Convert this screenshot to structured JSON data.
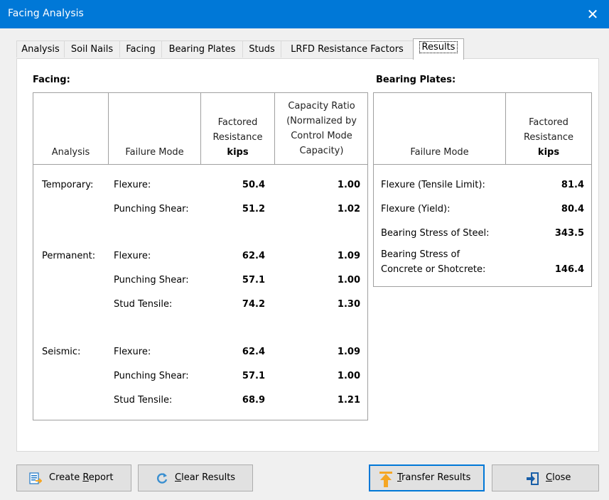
{
  "window": {
    "title": "Facing Analysis",
    "close_glyph": "✕"
  },
  "tabs": [
    {
      "label": "Analysis"
    },
    {
      "label": "Soil Nails"
    },
    {
      "label": "Facing"
    },
    {
      "label": "Bearing Plates"
    },
    {
      "label": "Studs"
    },
    {
      "label": "LRFD Resistance Factors"
    },
    {
      "label": "Results",
      "active": true
    }
  ],
  "facing": {
    "title": "Facing:",
    "headers": {
      "analysis": "Analysis",
      "failure_mode": "Failure Mode",
      "resistance_line1": "Factored",
      "resistance_line2": "Resistance",
      "resistance_unit": "kips",
      "ratio_line1": "Capacity Ratio",
      "ratio_line2": "(Normalized by",
      "ratio_line3": "Control Mode",
      "ratio_line4": "Capacity)"
    },
    "rows": [
      {
        "analysis": "Temporary:",
        "mode": "Flexure:",
        "resistance": "50.4",
        "ratio": "1.00"
      },
      {
        "analysis": "",
        "mode": "Punching Shear:",
        "resistance": "51.2",
        "ratio": "1.02"
      },
      {
        "analysis": "Permanent:",
        "mode": "Flexure:",
        "resistance": "62.4",
        "ratio": "1.09"
      },
      {
        "analysis": "",
        "mode": "Punching Shear:",
        "resistance": "57.1",
        "ratio": "1.00"
      },
      {
        "analysis": "",
        "mode": "Stud Tensile:",
        "resistance": "74.2",
        "ratio": "1.30"
      },
      {
        "analysis": "Seismic:",
        "mode": "Flexure:",
        "resistance": "62.4",
        "ratio": "1.09"
      },
      {
        "analysis": "",
        "mode": "Punching Shear:",
        "resistance": "57.1",
        "ratio": "1.00"
      },
      {
        "analysis": "",
        "mode": "Stud Tensile:",
        "resistance": "68.9",
        "ratio": "1.21"
      }
    ]
  },
  "bearing_plates": {
    "title": "Bearing Plates:",
    "headers": {
      "failure_mode": "Failure Mode",
      "resistance_line1": "Factored",
      "resistance_line2": "Resistance",
      "resistance_unit": "kips"
    },
    "rows": [
      {
        "mode": "Flexure (Tensile Limit):",
        "resistance": "81.4"
      },
      {
        "mode": "Flexure (Yield):",
        "resistance": "80.4"
      },
      {
        "mode": "Bearing Stress of Steel:",
        "resistance": "343.5"
      },
      {
        "mode_line1": "Bearing Stress of",
        "mode_line2": "Concrete or Shotcrete:",
        "resistance": "146.4"
      }
    ]
  },
  "buttons": {
    "create_report": {
      "pre": "Create ",
      "hot": "R",
      "post": "eport",
      "icon": "report-icon"
    },
    "clear_results": {
      "pre": "",
      "hot": "C",
      "post": "lear Results",
      "icon": "refresh-icon"
    },
    "transfer_results": {
      "pre": "",
      "hot": "T",
      "post": "ransfer Results",
      "icon": "upload-arrow-icon"
    },
    "close": {
      "pre": "",
      "hot": "C",
      "post": "lose",
      "icon": "exit-icon"
    }
  },
  "colors": {
    "titlebar": "#0078d7",
    "accent_orange": "#f5a623",
    "icon_blue": "#1e78c8"
  }
}
